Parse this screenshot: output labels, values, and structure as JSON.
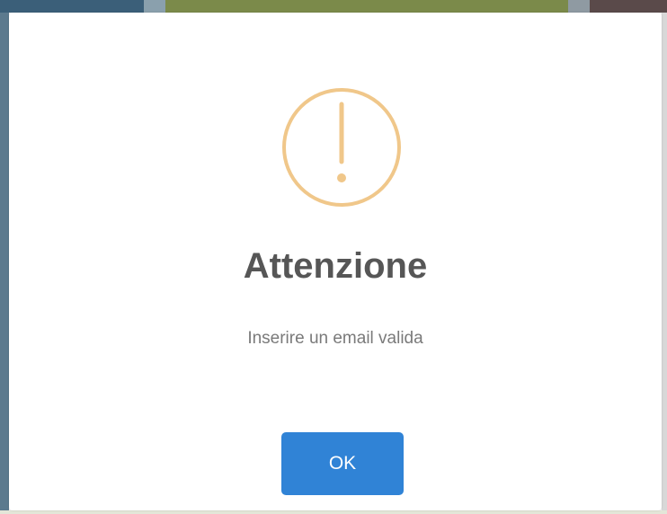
{
  "dialog": {
    "icon": "warning-exclamation-icon",
    "icon_color": "#f0c78a",
    "title": "Attenzione",
    "message": "Inserire un email valida",
    "confirm_label": "OK",
    "confirm_color": "#3083d6"
  }
}
